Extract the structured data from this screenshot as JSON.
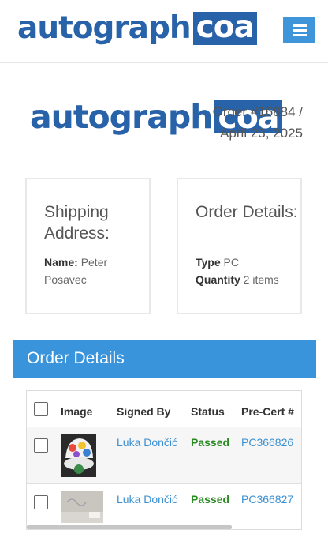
{
  "brand": {
    "word": "autograph",
    "box": "coa",
    "color": "#2862a8"
  },
  "header": {
    "menu_icon": "hamburger-icon",
    "menu_color": "#3f95d9"
  },
  "order": {
    "meta": "Order #16884 / April 23, 2025"
  },
  "shipping": {
    "title": "Shipping Address:",
    "name_label": "Name:",
    "name_value": "Peter Posavec"
  },
  "details_card": {
    "title": "Order Details:",
    "type_label": "Type",
    "type_value": "PC",
    "quantity_label": "Quantity",
    "quantity_value": "2 items"
  },
  "panel": {
    "title": "Order Details",
    "header_color": "#3a94db",
    "columns": [
      "Image",
      "Signed By",
      "Status",
      "Pre-Cert #"
    ],
    "rows": [
      {
        "signed_by": "Luka Dončić",
        "status": "Passed",
        "cert": "PC366826"
      },
      {
        "signed_by": "Luka Dončić",
        "status": "Passed",
        "cert": "PC366827"
      }
    ]
  }
}
